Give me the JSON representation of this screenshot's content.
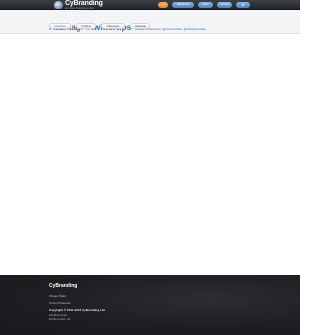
{
  "topbar": {
    "logo": {
      "name": "CyBranding",
      "tagline": "an online branding service"
    },
    "buttons": [
      {
        "label": ""
      },
      {
        "label": "Dashboard"
      },
      {
        "label": "Apps"
      },
      {
        "label": "Account"
      },
      {
        "label": ""
      }
    ]
  },
  "header": {
    "title_prefix": "Hashtag:",
    "hashtag": "#twittertips",
    "tracked_label": "Tracked influencers:",
    "tracked_links": [
      "@mimiscribble",
      "@twitterflowhide"
    ]
  },
  "tabs": [
    {
      "label": "Overview"
    },
    {
      "label": "Timeline"
    },
    {
      "label": "Influencers"
    },
    {
      "label": "Hashtags"
    }
  ],
  "footer": {
    "brand": "CyBranding",
    "links": [
      "Privacy Policy",
      "Terms Of Service"
    ],
    "copyright": "Copyright © 2011-2012 CyBranding Ltd.",
    "address_lines": [
      "221 Main Road",
      "EC1N London, UK"
    ]
  }
}
